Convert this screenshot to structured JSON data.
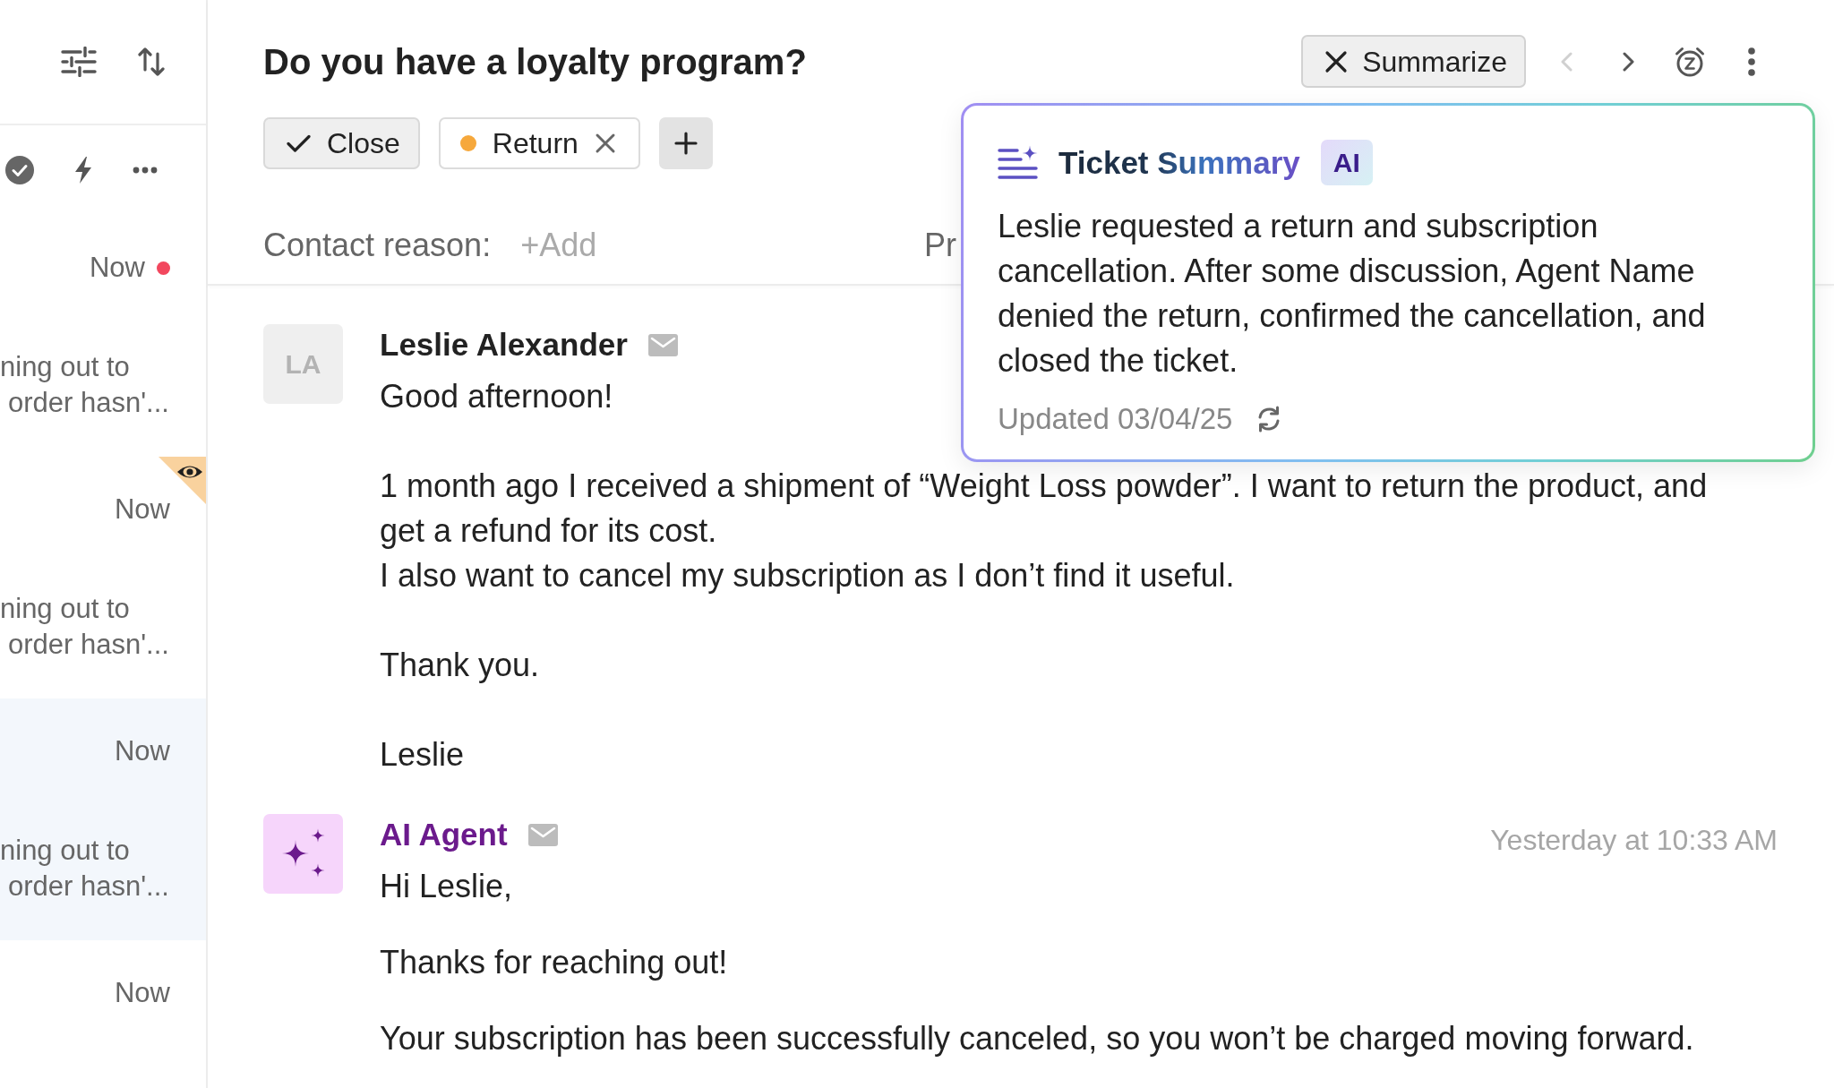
{
  "sidebar": {
    "conversations": [
      {
        "time": "Now",
        "unread": true,
        "viewer_badge": false,
        "selected": false,
        "preview": "ning out to order hasn'..."
      },
      {
        "time": "Now",
        "unread": false,
        "viewer_badge": true,
        "selected": false,
        "preview": "ning out to order hasn'..."
      },
      {
        "time": "Now",
        "unread": false,
        "viewer_badge": false,
        "selected": true,
        "preview": "ning out to order hasn'..."
      },
      {
        "time": "Now",
        "unread": false,
        "viewer_badge": false,
        "selected": false
      }
    ]
  },
  "ticket": {
    "title": "Do you have a loyalty program?",
    "summarize_label": "Summarize",
    "nav": {
      "prev_disabled": true,
      "next_disabled": false
    },
    "close_label": "Close",
    "tags": [
      {
        "label": "Return",
        "color": "#f6a83c"
      }
    ],
    "fields": [
      {
        "label": "Contact reason:",
        "add_label": "+Add"
      },
      {
        "label": "Pr"
      }
    ]
  },
  "summary": {
    "title": "Ticket Summary",
    "badge": "AI",
    "text": "Leslie requested a return and subscription cancellation. After some discussion, Agent Name denied the return, confirmed the cancellation, and closed the ticket.",
    "updated": "Updated 03/04/25"
  },
  "messages": [
    {
      "kind": "customer",
      "author": "Leslie Alexander",
      "initials": "LA",
      "paragraphs": [
        "Good afternoon!",
        "1 month ago I received a shipment of “Weight Loss powder”. I want to return the product, and get a refund for its cost.\nI also want to cancel my subscription as I don’t find it useful.",
        "Thank you.",
        "Leslie"
      ]
    },
    {
      "kind": "ai",
      "author": "AI Agent",
      "time": "Yesterday at 10:33 AM",
      "paragraphs": [
        "Hi Leslie,",
        "Thanks for reaching out!",
        "Your subscription has been successfully canceled, so you won’t be charged moving forward."
      ]
    }
  ]
}
